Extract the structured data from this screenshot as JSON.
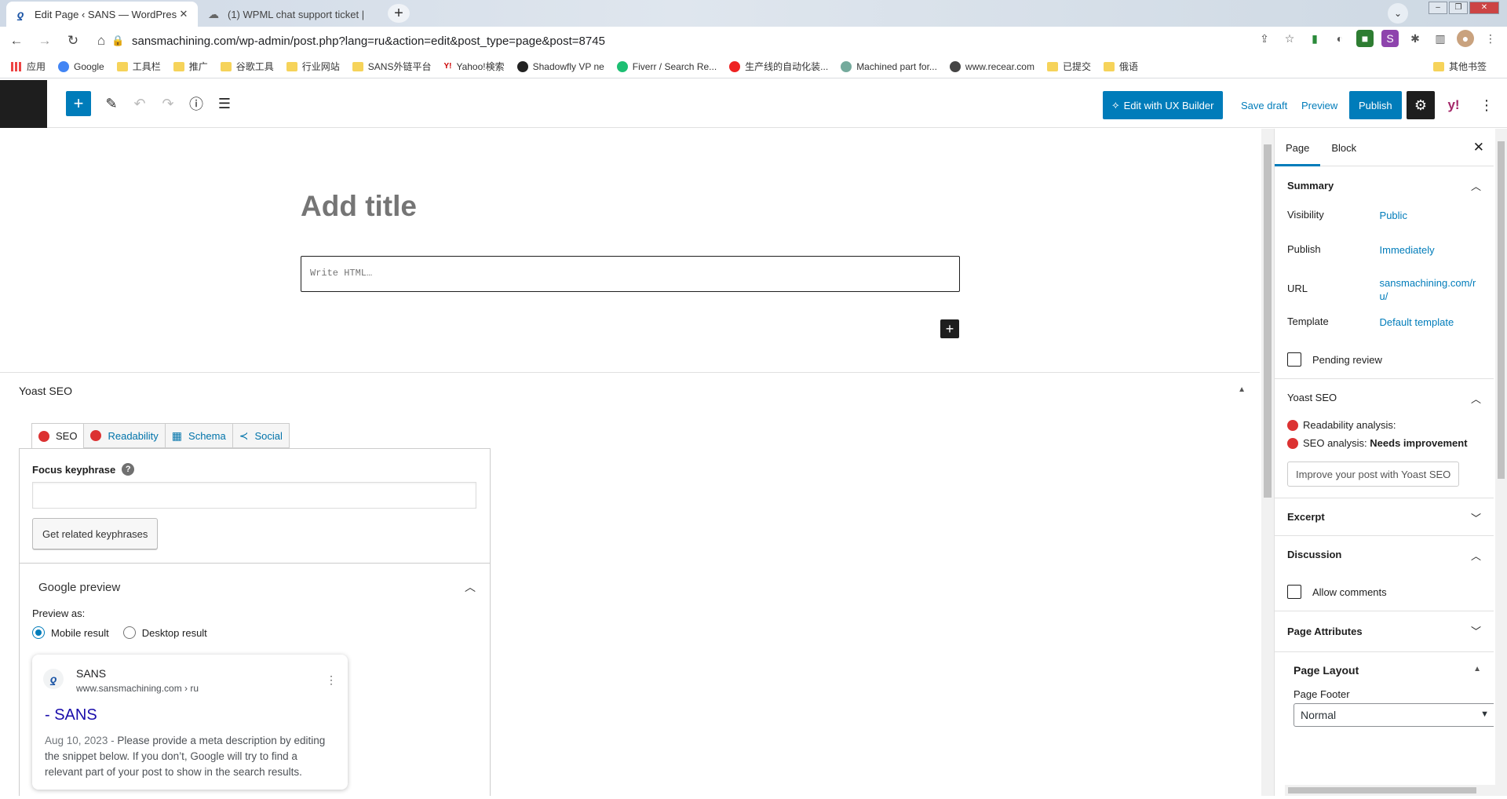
{
  "browser": {
    "tabs": [
      {
        "title": "Edit Page ‹ SANS — WordPres",
        "active": true
      },
      {
        "title": "(1) WPML chat support ticket |",
        "active": false
      }
    ],
    "new_tab": "+",
    "url": "sansmachining.com/wp-admin/post.php?lang=ru&action=edit&post_type=page&post=8745",
    "bookmarks": [
      "应用",
      "Google",
      "工具栏",
      "推广",
      "谷歌工具",
      "行业网站",
      "SANS外链平台",
      "Yahoo!検索",
      "Shadowfly VP ne",
      "Fiverr / Search Re...",
      "生产线的自动化装...",
      "Machined part for...",
      "www.recear.com",
      "已提交",
      "俄语"
    ],
    "bookmarks_other": "其他书签"
  },
  "header": {
    "ux_builder": "Edit with UX Builder",
    "save_draft": "Save draft",
    "preview": "Preview",
    "publish": "Publish"
  },
  "editor": {
    "title_placeholder": "Add title",
    "html_placeholder": "Write HTML…"
  },
  "yoast": {
    "box_title": "Yoast SEO",
    "tabs": [
      "SEO",
      "Readability",
      "Schema",
      "Social"
    ],
    "focus_keyphrase_label": "Focus keyphrase",
    "focus_keyphrase_value": "",
    "related_button": "Get related keyphrases",
    "google_preview": "Google preview",
    "preview_as": "Preview as:",
    "mobile_result": "Mobile result",
    "desktop_result": "Desktop result",
    "serp": {
      "site": "SANS",
      "url": "www.sansmachining.com › ru",
      "title": "- SANS",
      "date": "Aug 10, 2023",
      "sep": "-",
      "description": "Please provide a meta description by editing the snippet below. If you don’t, Google will try to find a relevant part of your post to show in the search results."
    }
  },
  "sidebar": {
    "tabs": [
      "Page",
      "Block"
    ],
    "summary": {
      "title": "Summary",
      "visibility_label": "Visibility",
      "visibility_value": "Public",
      "publish_label": "Publish",
      "publish_value": "Immediately",
      "url_label": "URL",
      "url_value": "sansmachining.com/ru/",
      "template_label": "Template",
      "template_value": "Default template",
      "pending_review": "Pending review"
    },
    "yoast": {
      "title": "Yoast SEO",
      "readability": "Readability analysis:",
      "seo_prefix": "SEO analysis:",
      "seo_value": "Needs improvement",
      "improve_button": "Improve your post with Yoast SEO"
    },
    "excerpt": "Excerpt",
    "discussion": {
      "title": "Discussion",
      "allow_comments": "Allow comments"
    },
    "page_attributes": "Page Attributes",
    "page_layout": {
      "title": "Page Layout",
      "footer_label": "Page Footer",
      "footer_value": "Normal"
    }
  },
  "colors": {
    "accent": "#007cba",
    "error": "#dc3232",
    "dark": "#1e1e1e"
  }
}
